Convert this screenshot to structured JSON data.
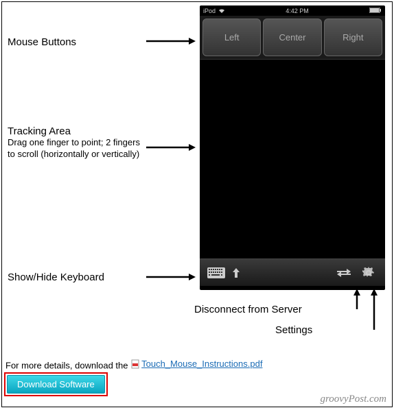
{
  "labels": {
    "mouse_buttons": "Mouse Buttons",
    "tracking_area": "Tracking Area",
    "tracking_sub": "Drag one finger to point; 2 fingers to scroll (horizontally or vertically)",
    "keyboard": "Show/Hide Keyboard",
    "disconnect": "Disconnect from Server",
    "settings": "Settings"
  },
  "phone": {
    "device": "iPod",
    "time": "4:42 PM",
    "buttons": {
      "left": "Left",
      "center": "Center",
      "right": "Right"
    }
  },
  "footer": {
    "prefix": "For more details, download the",
    "pdf_name": "Touch_Mouse_Instructions.pdf"
  },
  "download": "Download Software",
  "watermark": "groovyPost.com"
}
